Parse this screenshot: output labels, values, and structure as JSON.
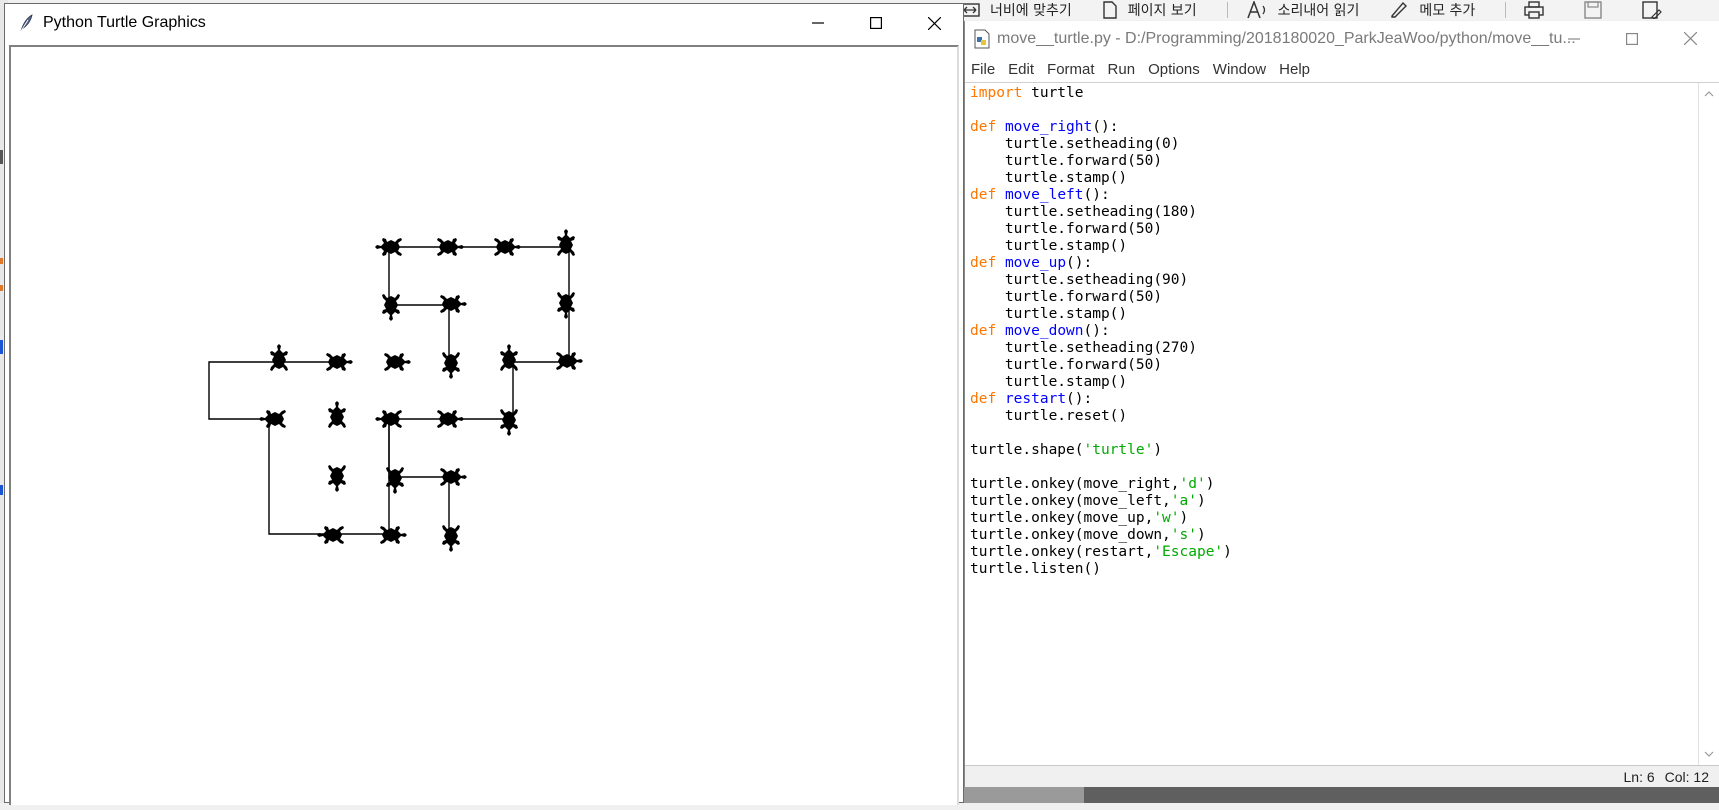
{
  "background_toolbar": {
    "items": [
      {
        "label": "너비에 맞추기",
        "icon": "fit-width-icon"
      },
      {
        "label": "페이지 보기",
        "icon": "page-view-icon"
      },
      {
        "label": "소리내어 읽기",
        "icon": "read-aloud-icon"
      },
      {
        "label": "메모 추가",
        "icon": "add-note-icon"
      }
    ],
    "extra_icons": [
      "print-icon",
      "save-icon",
      "save-as-icon"
    ]
  },
  "turtle_window": {
    "title": "Python Turtle Graphics",
    "icon": "feather-icon",
    "stamp_color": "#000000",
    "line_color": "#000000"
  },
  "idle_window": {
    "title": "move__turtle.py - D:/Programming/2018180020_ParkJeaWoo/python/move__tu...",
    "menu": [
      "File",
      "Edit",
      "Format",
      "Run",
      "Options",
      "Window",
      "Help"
    ],
    "code_lines": [
      [
        {
          "t": "import",
          "c": "kw"
        },
        {
          "t": " turtle",
          "c": "pl"
        }
      ],
      [],
      [
        {
          "t": "def",
          "c": "kw"
        },
        {
          "t": " ",
          "c": "pl"
        },
        {
          "t": "move_right",
          "c": "fn"
        },
        {
          "t": "():",
          "c": "pl"
        }
      ],
      [
        {
          "t": "    turtle.setheading(0)",
          "c": "pl"
        }
      ],
      [
        {
          "t": "    turtle.forward(50)",
          "c": "pl"
        }
      ],
      [
        {
          "t": "    turtle.stamp()",
          "c": "pl"
        }
      ],
      [
        {
          "t": "def",
          "c": "kw"
        },
        {
          "t": " ",
          "c": "pl"
        },
        {
          "t": "move_left",
          "c": "fn"
        },
        {
          "t": "():",
          "c": "pl"
        }
      ],
      [
        {
          "t": "    turtle.setheading(180)",
          "c": "pl"
        }
      ],
      [
        {
          "t": "    turtle.forward(50)",
          "c": "pl"
        }
      ],
      [
        {
          "t": "    turtle.stamp()",
          "c": "pl"
        }
      ],
      [
        {
          "t": "def",
          "c": "kw"
        },
        {
          "t": " ",
          "c": "pl"
        },
        {
          "t": "move_up",
          "c": "fn"
        },
        {
          "t": "():",
          "c": "pl"
        }
      ],
      [
        {
          "t": "    turtle.setheading(90)",
          "c": "pl"
        }
      ],
      [
        {
          "t": "    turtle.forward(50)",
          "c": "pl"
        }
      ],
      [
        {
          "t": "    turtle.stamp()",
          "c": "pl"
        }
      ],
      [
        {
          "t": "def",
          "c": "kw"
        },
        {
          "t": " ",
          "c": "pl"
        },
        {
          "t": "move_down",
          "c": "fn"
        },
        {
          "t": "():",
          "c": "pl"
        }
      ],
      [
        {
          "t": "    turtle.setheading(270)",
          "c": "pl"
        }
      ],
      [
        {
          "t": "    turtle.forward(50)",
          "c": "pl"
        }
      ],
      [
        {
          "t": "    turtle.stamp()",
          "c": "pl"
        }
      ],
      [
        {
          "t": "def",
          "c": "kw"
        },
        {
          "t": " ",
          "c": "pl"
        },
        {
          "t": "restart",
          "c": "fn"
        },
        {
          "t": "():",
          "c": "pl"
        }
      ],
      [
        {
          "t": "    turtle.reset()",
          "c": "pl"
        }
      ],
      [],
      [
        {
          "t": "turtle.shape(",
          "c": "pl"
        },
        {
          "t": "'turtle'",
          "c": "str"
        },
        {
          "t": ")",
          "c": "pl"
        }
      ],
      [],
      [
        {
          "t": "turtle.onkey(move_right,",
          "c": "pl"
        },
        {
          "t": "'d'",
          "c": "str"
        },
        {
          "t": ")",
          "c": "pl"
        }
      ],
      [
        {
          "t": "turtle.onkey(move_left,",
          "c": "pl"
        },
        {
          "t": "'a'",
          "c": "str"
        },
        {
          "t": ")",
          "c": "pl"
        }
      ],
      [
        {
          "t": "turtle.onkey(move_up,",
          "c": "pl"
        },
        {
          "t": "'w'",
          "c": "str"
        },
        {
          "t": ")",
          "c": "pl"
        }
      ],
      [
        {
          "t": "turtle.onkey(move_down,",
          "c": "pl"
        },
        {
          "t": "'s'",
          "c": "str"
        },
        {
          "t": ")",
          "c": "pl"
        }
      ],
      [
        {
          "t": "turtle.onkey(restart,",
          "c": "pl"
        },
        {
          "t": "'Escape'",
          "c": "str"
        },
        {
          "t": ")",
          "c": "pl"
        }
      ],
      [
        {
          "t": "turtle.listen()",
          "c": "pl"
        }
      ]
    ],
    "syntax_colors": {
      "kw": "#ff7700",
      "fn": "#0000ff",
      "str": "#00aa00",
      "pl": "#000000"
    },
    "status": {
      "line": "Ln: 6",
      "col": "Col: 12"
    }
  }
}
